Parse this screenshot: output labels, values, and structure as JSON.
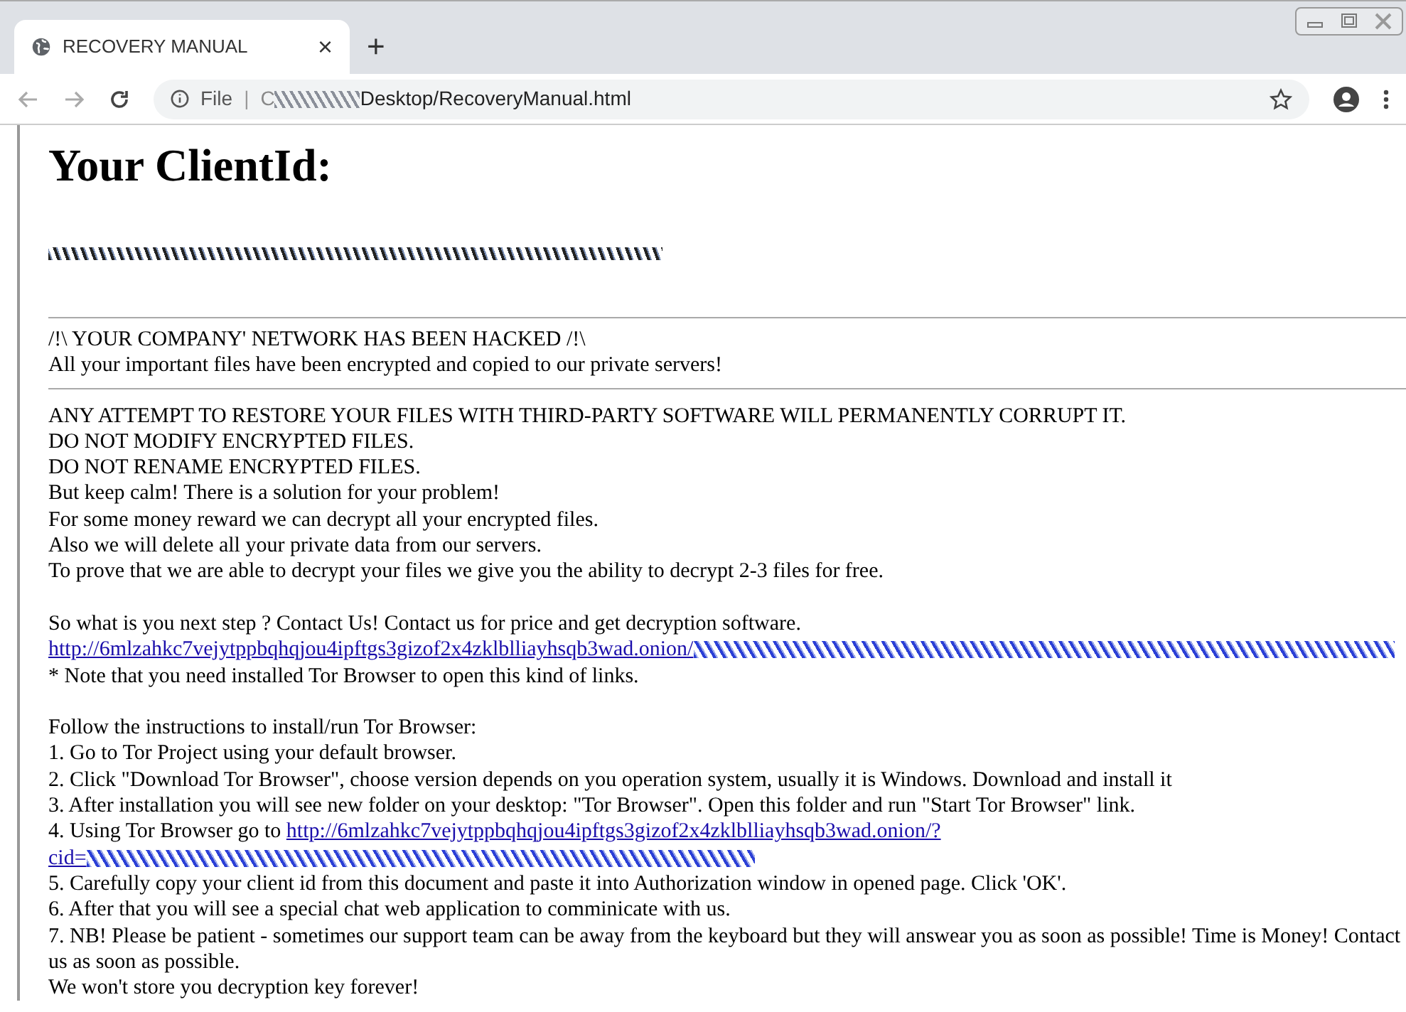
{
  "tab": {
    "title": "RECOVERY MANUAL",
    "close": "×",
    "new_tab": "+"
  },
  "address_bar": {
    "scheme_label": "File",
    "separator": "|",
    "url_prefix": "C",
    "url": "Desktop/RecoveryManual.html"
  },
  "heading": "Your ClientId:",
  "notice": [
    "/!\\ YOUR COMPANY' NETWORK HAS BEEN HACKED /!\\",
    "All your important files have been encrypted and copied to our private servers!"
  ],
  "body": [
    {
      "kind": "text",
      "text": "ANY ATTEMPT TO RESTORE YOUR FILES WITH THIRD-PARTY SOFTWARE WILL PERMANENTLY CORRUPT IT."
    },
    {
      "kind": "text",
      "text": "DO NOT MODIFY ENCRYPTED FILES."
    },
    {
      "kind": "text",
      "text": "DO NOT RENAME ENCRYPTED FILES."
    },
    {
      "kind": "text",
      "text": "But keep calm! There is a solution for your problem!"
    },
    {
      "kind": "text",
      "text": "For some money reward we can decrypt all your encrypted files."
    },
    {
      "kind": "text",
      "text": "Also we will delete all your private data from our servers."
    },
    {
      "kind": "text",
      "text": "To prove that we are able to decrypt your files we give you the ability to decrypt 2-3 files for free."
    },
    {
      "kind": "blank"
    },
    {
      "kind": "text",
      "text": "So what is you next step ? Contact Us! Contact us for price and get decryption software."
    },
    {
      "kind": "link",
      "link": "http://6mlzahkc7vejytppbqhqjou4ipftgs3gizof2x4zklblliayhsqb3wad.onion/",
      "redacted": true
    },
    {
      "kind": "text",
      "text": "* Note that you need installed Tor Browser to open this kind of links."
    },
    {
      "kind": "blank"
    },
    {
      "kind": "text",
      "text": "Follow the instructions to install/run Tor Browser:"
    },
    {
      "kind": "text",
      "text": "1. Go to Tor Project using your default browser."
    },
    {
      "kind": "text",
      "text": "2. Click \"Download Tor Browser\", choose version depends on you operation system, usually it is Windows. Download and install it"
    },
    {
      "kind": "text",
      "text": "3. After installation you will see new folder on your desktop: \"Tor Browser\". Open this folder and run \"Start Tor Browser\" link."
    },
    {
      "kind": "text_link",
      "text": "4. Using Tor Browser go to ",
      "link": "http://6mlzahkc7vejytppbqhqjou4ipftgs3gizof2x4zklblliayhsqb3wad.onion/?"
    },
    {
      "kind": "link",
      "link": "cid=",
      "redacted": true
    },
    {
      "kind": "text",
      "text": "5. Carefully copy your client id from this document and paste it into Authorization window in opened page. Click 'OK'."
    },
    {
      "kind": "text",
      "text": "6. After that you will see a special chat web application to comminicate with us."
    },
    {
      "kind": "text",
      "text": "7. NB! Please be patient - sometimes our support team can be away from the keyboard but they will answear you as soon as possible! Time is Money! Contact us as soon as possible."
    },
    {
      "kind": "text",
      "text": "We won't store you decryption key forever!"
    }
  ]
}
